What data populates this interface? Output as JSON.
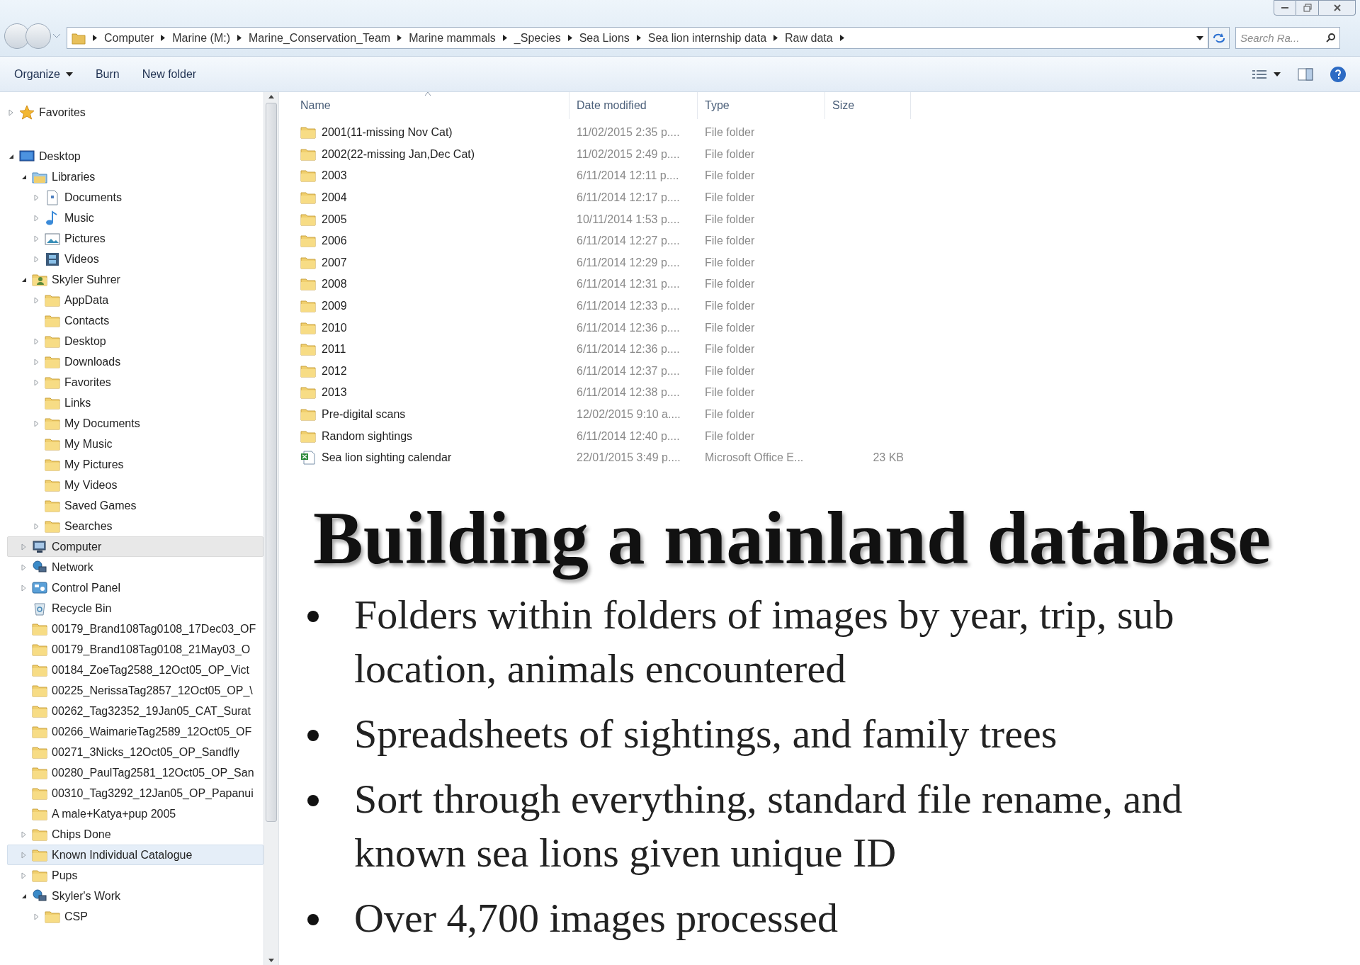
{
  "address_bar": {
    "breadcrumbs": [
      "Computer",
      "Marine (M:)",
      "Marine_Conservation_Team",
      "Marine mammals",
      "_Species",
      "Sea Lions",
      "Sea lion internship data",
      "Raw data"
    ]
  },
  "search": {
    "placeholder": "Search Ra..."
  },
  "toolbar": {
    "buttons": [
      {
        "label": "Organize",
        "dropdown": true
      },
      {
        "label": "Burn",
        "dropdown": false
      },
      {
        "label": "New folder",
        "dropdown": false
      }
    ]
  },
  "navigation_pane": {
    "items": [
      {
        "label": "Favorites",
        "kind": "star",
        "expandable": true,
        "expanded": false,
        "highlighted": false
      },
      {
        "label": "Desktop",
        "kind": "desktop",
        "expandable": true,
        "expanded": true,
        "highlighted": false,
        "children": [
          {
            "label": "Libraries",
            "kind": "library",
            "expandable": true,
            "expanded": true,
            "highlighted": false,
            "children": [
              {
                "label": "Documents",
                "kind": "document",
                "expandable": true,
                "expanded": false,
                "highlighted": false
              },
              {
                "label": "Music",
                "kind": "music",
                "expandable": true,
                "expanded": false,
                "highlighted": false
              },
              {
                "label": "Pictures",
                "kind": "picture",
                "expandable": true,
                "expanded": false,
                "highlighted": false
              },
              {
                "label": "Videos",
                "kind": "video",
                "expandable": true,
                "expanded": false,
                "highlighted": false
              }
            ]
          },
          {
            "label": "Skyler Suhrer",
            "kind": "user",
            "expandable": true,
            "expanded": true,
            "highlighted": false,
            "children": [
              {
                "label": "AppData",
                "kind": "folder",
                "expandable": true,
                "expanded": false,
                "highlighted": false
              },
              {
                "label": "Contacts",
                "kind": "folder",
                "expandable": false,
                "expanded": false,
                "highlighted": false
              },
              {
                "label": "Desktop",
                "kind": "folder",
                "expandable": true,
                "expanded": false,
                "highlighted": false
              },
              {
                "label": "Downloads",
                "kind": "folder",
                "expandable": true,
                "expanded": false,
                "highlighted": false
              },
              {
                "label": "Favorites",
                "kind": "folder",
                "expandable": true,
                "expanded": false,
                "highlighted": false
              },
              {
                "label": "Links",
                "kind": "folder",
                "expandable": false,
                "expanded": false,
                "highlighted": false
              },
              {
                "label": "My Documents",
                "kind": "folder",
                "expandable": true,
                "expanded": false,
                "highlighted": false
              },
              {
                "label": "My Music",
                "kind": "folder",
                "expandable": false,
                "expanded": false,
                "highlighted": false
              },
              {
                "label": "My Pictures",
                "kind": "folder",
                "expandable": false,
                "expanded": false,
                "highlighted": false
              },
              {
                "label": "My Videos",
                "kind": "folder",
                "expandable": false,
                "expanded": false,
                "highlighted": false
              },
              {
                "label": "Saved Games",
                "kind": "folder",
                "expandable": false,
                "expanded": false,
                "highlighted": false
              },
              {
                "label": "Searches",
                "kind": "folder",
                "expandable": true,
                "expanded": false,
                "highlighted": false
              }
            ]
          },
          {
            "label": "Computer",
            "kind": "computer",
            "expandable": true,
            "expanded": false,
            "highlighted": true
          },
          {
            "label": "Network",
            "kind": "network",
            "expandable": true,
            "expanded": false,
            "highlighted": false
          },
          {
            "label": "Control Panel",
            "kind": "control",
            "expandable": true,
            "expanded": false,
            "highlighted": false
          },
          {
            "label": "Recycle Bin",
            "kind": "recycle",
            "expandable": false,
            "expanded": false,
            "highlighted": false
          },
          {
            "label": "00179_Brand108Tag0108_17Dec03_OF",
            "kind": "folder",
            "expandable": false,
            "expanded": false,
            "highlighted": false
          },
          {
            "label": "00179_Brand108Tag0108_21May03_O",
            "kind": "folder",
            "expandable": false,
            "expanded": false,
            "highlighted": false
          },
          {
            "label": "00184_ZoeTag2588_12Oct05_OP_Vict",
            "kind": "folder",
            "expandable": false,
            "expanded": false,
            "highlighted": false
          },
          {
            "label": "00225_NerissaTag2857_12Oct05_OP_\\",
            "kind": "folder",
            "expandable": false,
            "expanded": false,
            "highlighted": false
          },
          {
            "label": "00262_Tag32352_19Jan05_CAT_Surat",
            "kind": "folder",
            "expandable": false,
            "expanded": false,
            "highlighted": false
          },
          {
            "label": "00266_WaimarieTag2589_12Oct05_OF",
            "kind": "folder",
            "expandable": false,
            "expanded": false,
            "highlighted": false
          },
          {
            "label": "00271_3Nicks_12Oct05_OP_Sandfly",
            "kind": "folder",
            "expandable": false,
            "expanded": false,
            "highlighted": false
          },
          {
            "label": "00280_PaulTag2581_12Oct05_OP_San",
            "kind": "folder",
            "expandable": false,
            "expanded": false,
            "highlighted": false
          },
          {
            "label": "00310_Tag3292_12Jan05_OP_Papanui",
            "kind": "folder",
            "expandable": false,
            "expanded": false,
            "highlighted": false
          },
          {
            "label": "A male+Katya+pup 2005",
            "kind": "folder",
            "expandable": false,
            "expanded": false,
            "highlighted": false
          },
          {
            "label": "Chips Done",
            "kind": "folder",
            "expandable": true,
            "expanded": false,
            "highlighted": false
          },
          {
            "label": "Known Individual Catalogue",
            "kind": "folder",
            "expandable": true,
            "expanded": false,
            "highlighted": true
          },
          {
            "label": "Pups",
            "kind": "folder",
            "expandable": true,
            "expanded": false,
            "highlighted": false
          },
          {
            "label": "Skyler's Work",
            "kind": "network",
            "expandable": true,
            "expanded": true,
            "highlighted": false,
            "children": [
              {
                "label": "CSP",
                "kind": "folder",
                "expandable": true,
                "expanded": false,
                "highlighted": false
              }
            ]
          }
        ]
      }
    ]
  },
  "file_list": {
    "columns": [
      "Name",
      "Date modified",
      "Type",
      "Size"
    ],
    "rows": [
      {
        "kind": "folder",
        "name": "2001(11-missing Nov Cat)",
        "date_modified": "11/02/2015 2:35 p....",
        "type": "File folder"
      },
      {
        "kind": "folder",
        "name": "2002(22-missing Jan,Dec Cat)",
        "date_modified": "11/02/2015 2:49 p....",
        "type": "File folder"
      },
      {
        "kind": "folder",
        "name": "2003",
        "date_modified": "6/11/2014 12:11 p....",
        "type": "File folder"
      },
      {
        "kind": "folder",
        "name": "2004",
        "date_modified": "6/11/2014 12:17 p....",
        "type": "File folder"
      },
      {
        "kind": "folder",
        "name": "2005",
        "date_modified": "10/11/2014 1:53 p....",
        "type": "File folder"
      },
      {
        "kind": "folder",
        "name": "2006",
        "date_modified": "6/11/2014 12:27 p....",
        "type": "File folder"
      },
      {
        "kind": "folder",
        "name": "2007",
        "date_modified": "6/11/2014 12:29 p....",
        "type": "File folder"
      },
      {
        "kind": "folder",
        "name": "2008",
        "date_modified": "6/11/2014 12:31 p....",
        "type": "File folder"
      },
      {
        "kind": "folder",
        "name": "2009",
        "date_modified": "6/11/2014 12:33 p....",
        "type": "File folder"
      },
      {
        "kind": "folder",
        "name": "2010",
        "date_modified": "6/11/2014 12:36 p....",
        "type": "File folder"
      },
      {
        "kind": "folder",
        "name": "2011",
        "date_modified": "6/11/2014 12:36 p....",
        "type": "File folder"
      },
      {
        "kind": "folder",
        "name": "2012",
        "date_modified": "6/11/2014 12:37 p....",
        "type": "File folder"
      },
      {
        "kind": "folder",
        "name": "2013",
        "date_modified": "6/11/2014 12:38 p....",
        "type": "File folder"
      },
      {
        "kind": "folder",
        "name": "Pre-digital scans",
        "date_modified": "12/02/2015 9:10 a....",
        "type": "File folder"
      },
      {
        "kind": "folder",
        "name": "Random sightings",
        "date_modified": "6/11/2014 12:40 p....",
        "type": "File folder"
      },
      {
        "kind": "spreadsheet",
        "name": "Sea lion sighting calendar",
        "date_modified": "22/01/2015 3:49 p....",
        "type": "Microsoft Office E...",
        "size": "23 KB"
      }
    ]
  },
  "slide": {
    "title": "Building a mainland database",
    "bullets": [
      "Folders within folders of images by year, trip, sub location, animals encountered",
      "Spreadsheets of sightings, and family trees",
      "Sort through everything, standard file rename, and known sea lions given unique ID",
      "Over 4,700 images processed"
    ]
  }
}
